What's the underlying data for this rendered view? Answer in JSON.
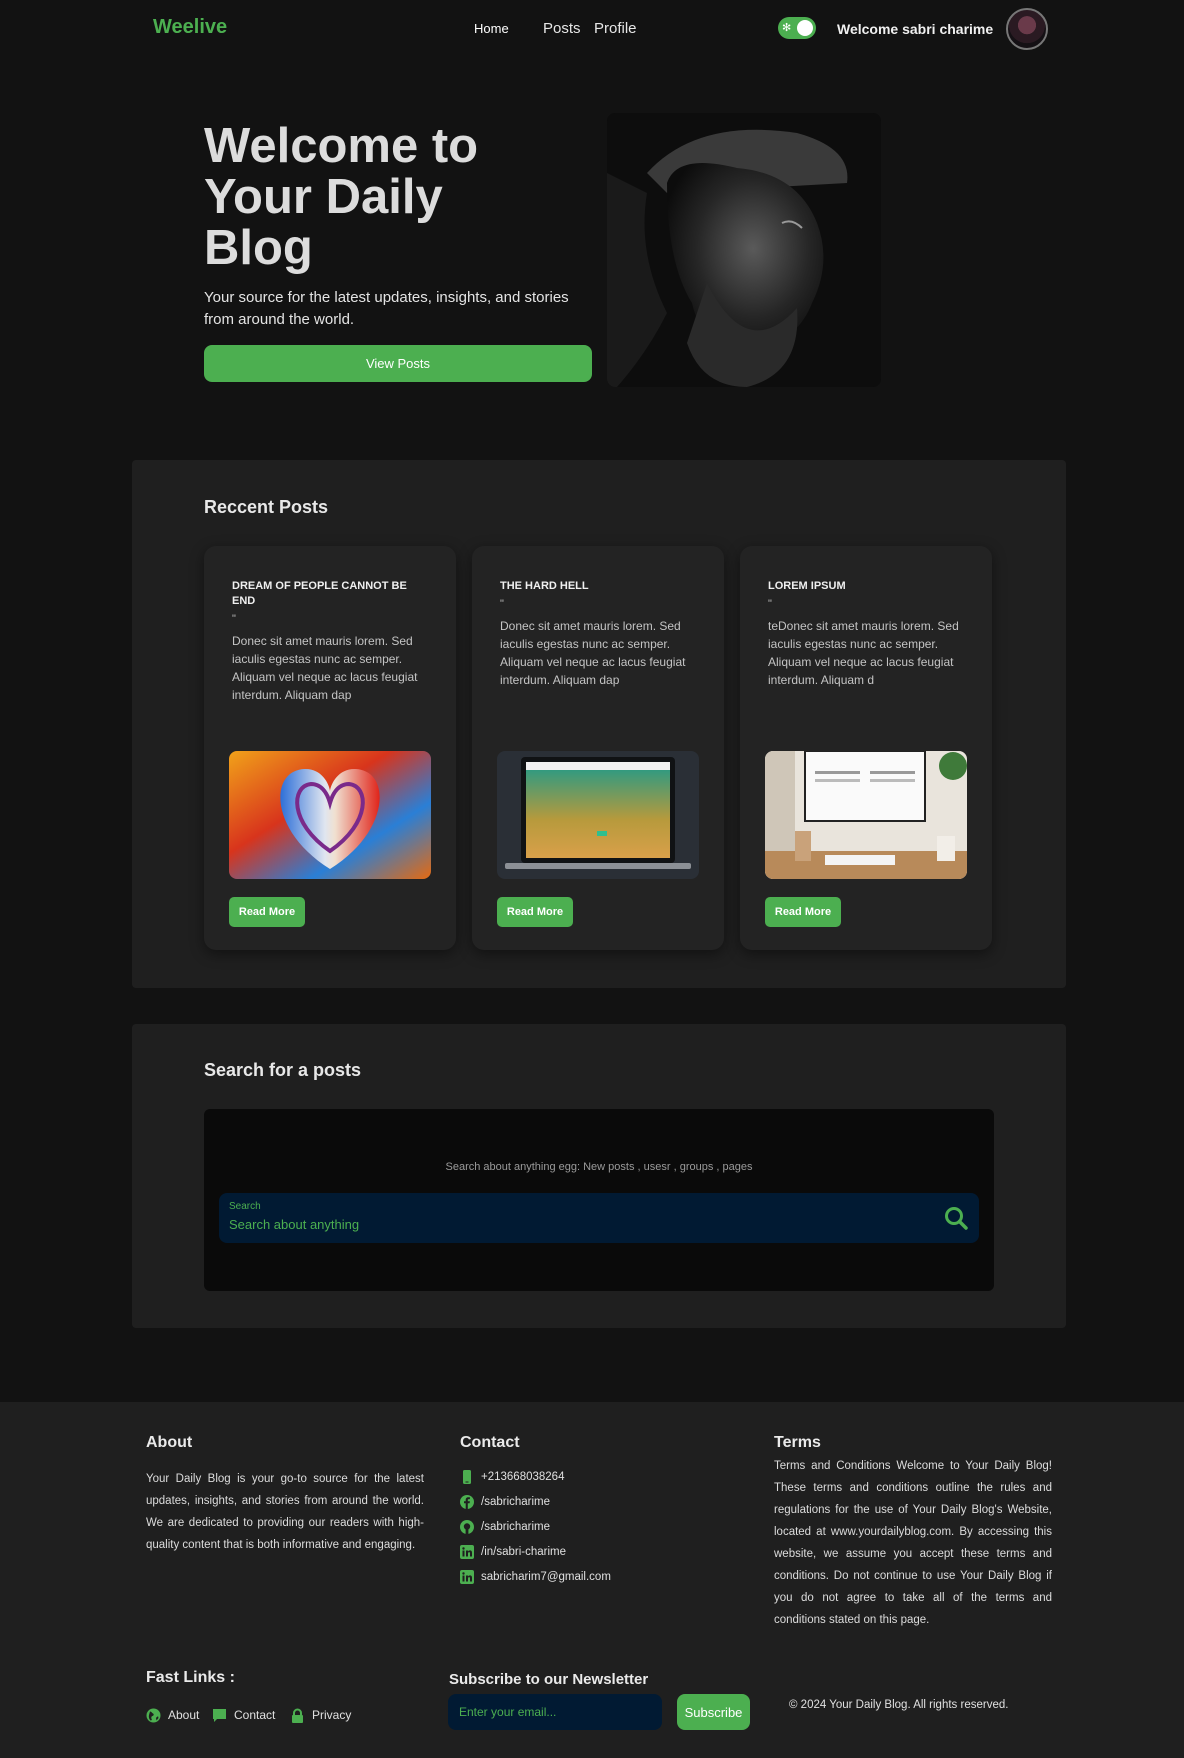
{
  "nav": {
    "brand": "Weelive",
    "links": [
      "Home",
      "Posts",
      "Profile"
    ],
    "welcome": "Welcome sabri charime"
  },
  "hero": {
    "title": "Welcome to Your Daily Blog",
    "subtitle": "Your source for the latest updates, insights, and stories from around the world.",
    "button": "View Posts"
  },
  "recent": {
    "title": "Reccent Posts",
    "posts": [
      {
        "title": "DREAM OF PEOPLE CANNOT BE END",
        "quote": "\"",
        "excerpt": "Donec sit amet mauris lorem. Sed iaculis egestas nunc ac semper. Aliquam vel neque ac lacus feugiat interdum. Aliquam dap",
        "button": "Read More"
      },
      {
        "title": "THE HARD HELL",
        "quote": "\"",
        "excerpt": "Donec sit amet mauris lorem. Sed iaculis egestas nunc ac semper. Aliquam vel neque ac lacus feugiat interdum. Aliquam dap",
        "button": "Read More"
      },
      {
        "title": "LOREM IPSUM",
        "quote": "\"",
        "excerpt": "teDonec sit amet mauris lorem. Sed iaculis egestas nunc ac semper. Aliquam vel neque ac lacus feugiat interdum. Aliquam d",
        "button": "Read More"
      }
    ]
  },
  "search": {
    "title": "Search for a posts",
    "hint": "Search about anything egg: New posts , usesr , groups , pages",
    "label": "Search",
    "placeholder": "Search about anything"
  },
  "footer": {
    "about": {
      "title": "About",
      "text": "Your Daily Blog is your go-to source for the latest updates, insights, and stories from around the world. We are dedicated to providing our readers with high-quality content that is both informative and engaging."
    },
    "contact": {
      "title": "Contact",
      "items": [
        {
          "icon": "phone-icon",
          "text": "+213668038264"
        },
        {
          "icon": "facebook-icon",
          "text": "/sabricharime"
        },
        {
          "icon": "github-icon",
          "text": "/sabricharime"
        },
        {
          "icon": "linkedin-icon",
          "text": "/in/sabri-charime"
        },
        {
          "icon": "linkedin-icon",
          "text": "sabricharim7@gmail.com"
        }
      ]
    },
    "terms": {
      "title": "Terms",
      "text": "Terms and Conditions Welcome to Your Daily Blog! These terms and conditions outline the rules and regulations for the use of Your Daily Blog's Website, located at www.yourdailyblog.com. By accessing this website, we assume you accept these terms and conditions. Do not continue to use Your Daily Blog if you do not agree to take all of the terms and conditions stated on this page."
    },
    "fast_links": {
      "title": "Fast Links :",
      "items": [
        {
          "icon": "globe-icon",
          "label": "About"
        },
        {
          "icon": "chat-icon",
          "label": "Contact"
        },
        {
          "icon": "lock-icon",
          "label": "Privacy"
        }
      ]
    },
    "newsletter": {
      "title": "Subscribe to our Newsletter",
      "placeholder": "Enter your email...",
      "button": "Subscribe"
    },
    "copyright": "© 2024 Your Daily Blog. All rights reserved."
  },
  "colors": {
    "accent": "#4caf50",
    "background": "#121212",
    "panel": "#1f1f1f",
    "input": "#011a33"
  }
}
